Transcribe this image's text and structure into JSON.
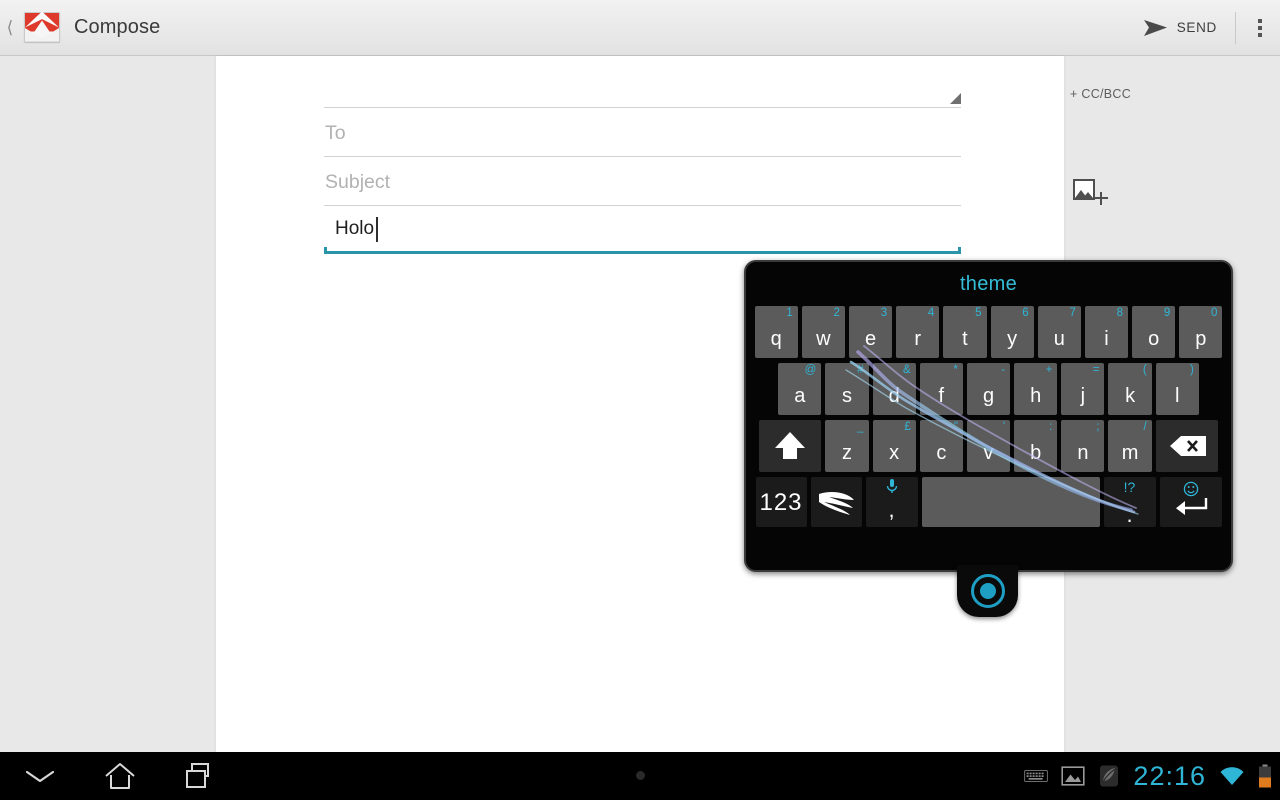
{
  "actionbar": {
    "back_icon": "chevron-left-icon",
    "app_logo": "gmail-logo",
    "title": "Compose",
    "send_label": "SEND",
    "send_icon": "send-arrow-icon",
    "overflow_icon": "overflow-menu-icon"
  },
  "compose": {
    "from_field_value": "",
    "from_expand_icon": "expand-handle-icon",
    "to_placeholder": "To",
    "cc_bcc_label": "+ CC/BCC",
    "subject_placeholder": "Subject",
    "attach_image_icon": "add-image-icon",
    "body_text": "Holo",
    "body_focus_color": "#2a94a8"
  },
  "keyboard": {
    "suggestion": "theme",
    "suggestion_color": "#35bdd8",
    "row1": [
      {
        "key": "q",
        "alt": "1"
      },
      {
        "key": "w",
        "alt": "2"
      },
      {
        "key": "e",
        "alt": "3"
      },
      {
        "key": "r",
        "alt": "4"
      },
      {
        "key": "t",
        "alt": "5"
      },
      {
        "key": "y",
        "alt": "6"
      },
      {
        "key": "u",
        "alt": "7"
      },
      {
        "key": "i",
        "alt": "8"
      },
      {
        "key": "o",
        "alt": "9"
      },
      {
        "key": "p",
        "alt": "0"
      }
    ],
    "row2": [
      {
        "key": "a",
        "alt": "@"
      },
      {
        "key": "s",
        "alt": "#"
      },
      {
        "key": "d",
        "alt": "&"
      },
      {
        "key": "f",
        "alt": "*"
      },
      {
        "key": "g",
        "alt": "-"
      },
      {
        "key": "h",
        "alt": "+"
      },
      {
        "key": "j",
        "alt": "="
      },
      {
        "key": "k",
        "alt": "("
      },
      {
        "key": "l",
        "alt": ")"
      }
    ],
    "row3": [
      {
        "key": "z",
        "alt": "_"
      },
      {
        "key": "x",
        "alt": "£"
      },
      {
        "key": "c",
        "alt": "\""
      },
      {
        "key": "v",
        "alt": "'"
      },
      {
        "key": "b",
        "alt": ":"
      },
      {
        "key": "n",
        "alt": ";"
      },
      {
        "key": "m",
        "alt": "/"
      }
    ],
    "shift_icon": "shift-icon",
    "backspace_icon": "backspace-icon",
    "numeric_label": "123",
    "logo_icon": "swiftkey-logo-icon",
    "comma_label": ",",
    "mic_icon": "microphone-icon",
    "space_label": "",
    "period_label": ".",
    "punct_alt_label": "!?",
    "emoji_icon": "smiley-icon",
    "enter_icon": "enter-icon",
    "handle_icon": "keyboard-resize-handle-icon",
    "key_color": "#5b5b5b",
    "fn_key_color": "#1b1b1b",
    "alt_label_color": "#2fb5d6"
  },
  "navbar": {
    "back_icon": "hide-keyboard-icon",
    "home_icon": "home-icon",
    "recents_icon": "recent-apps-icon",
    "notification_dot": "notification-dot"
  },
  "statusbar": {
    "keyboard_icon": "keyboard-indicator-icon",
    "screenshot_icon": "screenshot-icon",
    "app_icon": "swiftkey-notification-icon",
    "clock": "22:16",
    "clock_color": "#2fb5d6",
    "wifi_icon": "wifi-icon",
    "battery_icon": "battery-icon",
    "battery_color": "#e07b1e"
  }
}
